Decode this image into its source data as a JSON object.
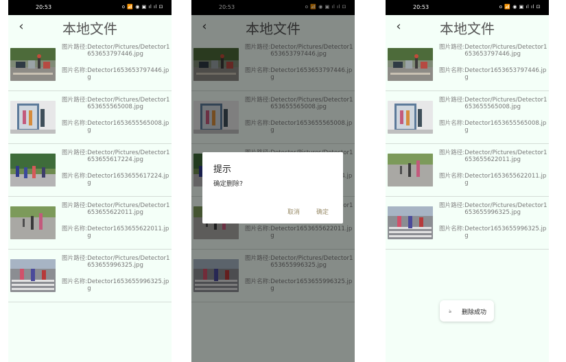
{
  "status_bar": {
    "time": "20:53",
    "icons_text": "ᴏ 📶 ◉ ▣ ıl ıl ⊡"
  },
  "app_bar": {
    "back_icon": "chevron-left",
    "title": "本地文件"
  },
  "labels": {
    "path": "图片路径:",
    "name": "图片名称:"
  },
  "list_before": [
    {
      "thumb": "street-crossing",
      "path": "Detector/Pictures/Detector1653653797446.jpg",
      "name": "Detector1653653797446.jpg"
    },
    {
      "thumb": "door-people",
      "path": "Detector/Pictures/Detector1653655565008.jpg",
      "name": "Detector1653655565008.jpg"
    },
    {
      "thumb": "crowd-street",
      "path": "Detector/Pictures/Detector1653655617224.jpg",
      "name": "Detector1653655617224.jpg"
    },
    {
      "thumb": "road-walkers",
      "path": "Detector/Pictures/Detector1653655622011.jpg",
      "name": "Detector1653655622011.jpg"
    },
    {
      "thumb": "zebra-crossing",
      "path": "Detector/Pictures/Detector1653655996325.jpg",
      "name": "Detector1653655996325.jpg"
    }
  ],
  "list_after": [
    {
      "thumb": "street-crossing",
      "path": "Detector/Pictures/Detector1653653797446.jpg",
      "name": "Detector1653653797446.jpg"
    },
    {
      "thumb": "door-people",
      "path": "Detector/Pictures/Detector1653655565008.jpg",
      "name": "Detector1653655565008.jpg"
    },
    {
      "thumb": "road-walkers",
      "path": "Detector/Pictures/Detector1653655622011.jpg",
      "name": "Detector1653655622011.jpg"
    },
    {
      "thumb": "zebra-crossing",
      "path": "Detector/Pictures/Detector1653655996325.jpg",
      "name": "Detector1653655996325.jpg"
    }
  ],
  "dialog": {
    "title": "提示",
    "message": "确定删除?",
    "cancel": "取消",
    "confirm": "确定"
  },
  "toast": {
    "icon": "app-icon",
    "message": "删除成功"
  },
  "colors": {
    "background": "#f4fff8",
    "divider": "#d4dcd6",
    "dialog_button": "#9a8d6a",
    "status_bar": "#000000"
  }
}
